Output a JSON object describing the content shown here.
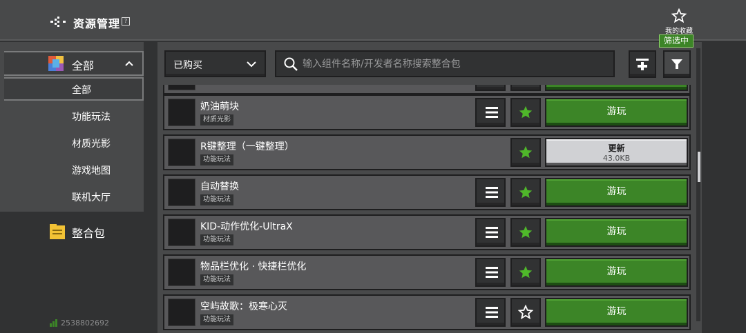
{
  "header": {
    "title": "资源管理",
    "help_symbol": "?",
    "favorites_label": "我的收藏"
  },
  "sidebar": {
    "category_label": "全部",
    "sub_items": [
      "全部",
      "功能玩法",
      "材质光影",
      "游戏地图",
      "联机大厅"
    ],
    "modpack_label": "整合包",
    "user_id": "2538802692"
  },
  "toolbar": {
    "dropdown_value": "已购买",
    "search_placeholder": "输入组件名称/开发者名称搜索整合包",
    "filter_badge": "筛选中"
  },
  "items": [
    {
      "name": "奶油萌块",
      "tag": "材质光影",
      "has_menu": true,
      "favorited": true,
      "action": "play",
      "action_label": "游玩"
    },
    {
      "name": "R键整理（一键整理）",
      "tag": "功能玩法",
      "has_menu": false,
      "favorited": true,
      "action": "update",
      "action_label": "更新",
      "size": "43.0KB"
    },
    {
      "name": "自动替换",
      "tag": "功能玩法",
      "has_menu": true,
      "favorited": true,
      "action": "play",
      "action_label": "游玩"
    },
    {
      "name": "KID-动作优化-UltraX",
      "tag": "功能玩法",
      "has_menu": true,
      "favorited": true,
      "action": "play",
      "action_label": "游玩"
    },
    {
      "name": "物品栏优化 · 快捷栏优化",
      "tag": "功能玩法",
      "has_menu": true,
      "favorited": true,
      "action": "play",
      "action_label": "游玩"
    },
    {
      "name": "空屿故歌：极寒心灭",
      "tag": "功能玩法",
      "has_menu": true,
      "favorited": false,
      "action": "play",
      "action_label": "游玩"
    }
  ],
  "colors": {
    "accent_green": "#3c8527",
    "star_green": "#4fb82a"
  }
}
